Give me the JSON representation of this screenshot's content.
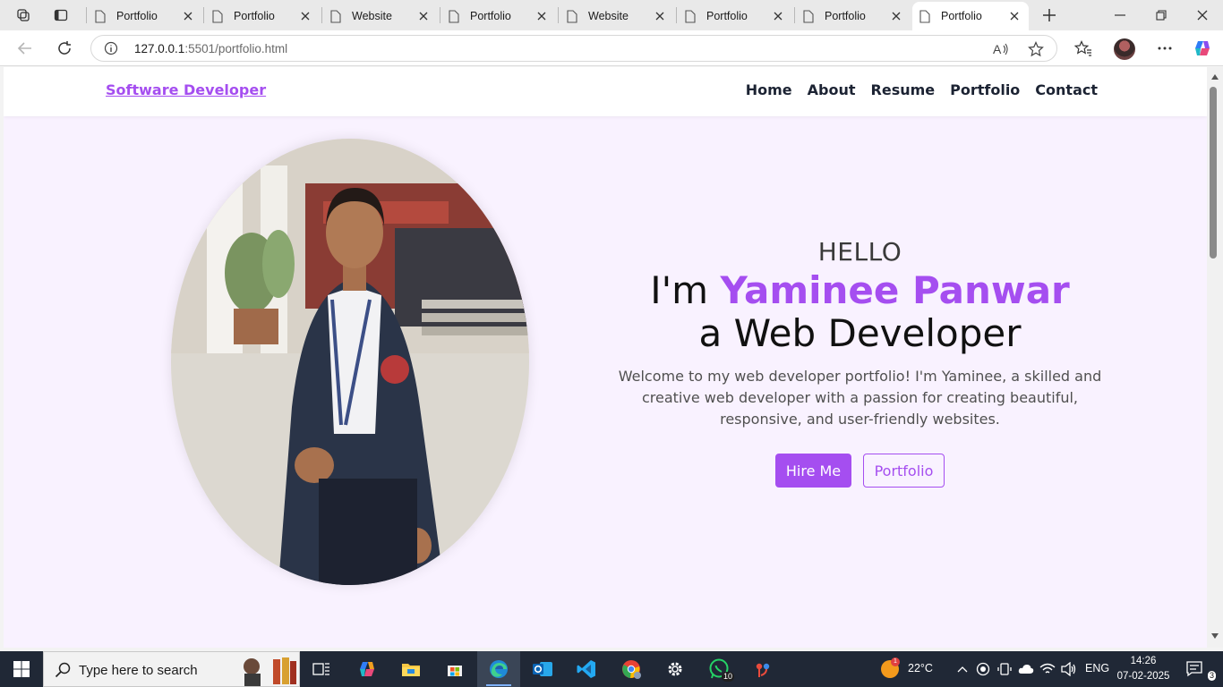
{
  "browser": {
    "tabs": [
      {
        "title": "Portfolio",
        "active": false
      },
      {
        "title": "Portfolio",
        "active": false
      },
      {
        "title": "Website",
        "active": false
      },
      {
        "title": "Portfolio",
        "active": false
      },
      {
        "title": "Website",
        "active": false
      },
      {
        "title": "Portfolio",
        "active": false
      },
      {
        "title": "Portfolio",
        "active": false
      },
      {
        "title": "Portfolio",
        "active": true
      }
    ],
    "address": {
      "host": "127.0.0.1",
      "rest": ":5501/portfolio.html"
    }
  },
  "page": {
    "brand": "Software Developer",
    "nav": [
      "Home",
      "About",
      "Resume",
      "Portfolio",
      "Contact"
    ],
    "hero": {
      "greeting": "HELLO",
      "intro_prefix": "I'm ",
      "name": "Yaminee Panwar",
      "role_line": "a Web Developer",
      "description": "Welcome to my web developer portfolio! I'm Yaminee, a skilled and creative web developer with a passion for creating beautiful, responsive, and user-friendly websites.",
      "primary_button": "Hire Me",
      "secondary_button": "Portfolio"
    },
    "accent_color": "#a54ef0"
  },
  "taskbar": {
    "search_placeholder": "Type here to search",
    "whatsapp_badge": "10",
    "weather": "22°C",
    "weather_badge": "1",
    "language": "ENG",
    "time": "14:26",
    "date": "07-02-2025",
    "notification_count": "3"
  }
}
